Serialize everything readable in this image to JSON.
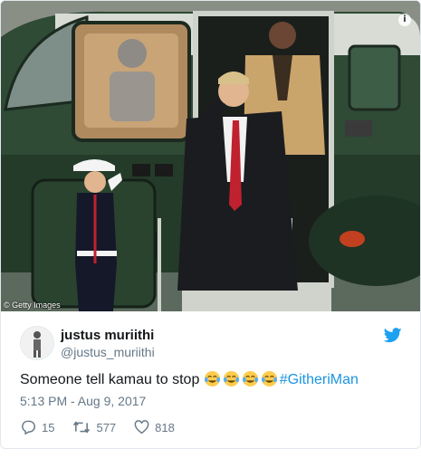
{
  "image": {
    "credit": "© Getty Images",
    "info_icon": "info-icon"
  },
  "tweet": {
    "display_name": "justus muriithi",
    "handle": "@justus_muriithi",
    "text": "Someone tell kamau to stop ",
    "emoji": [
      "face-with-tears-of-joy",
      "face-with-tears-of-joy",
      "face-with-tears-of-joy",
      "face-with-tears-of-joy"
    ],
    "hashtag": "#GitheriMan",
    "timestamp": "5:13 PM - Aug 9, 2017",
    "replies": "15",
    "retweets": "577",
    "likes": "818"
  },
  "colors": {
    "twitter_blue": "#1da1f2",
    "hashtag": "#1b95e0",
    "muted": "#657786",
    "text": "#14171a"
  }
}
